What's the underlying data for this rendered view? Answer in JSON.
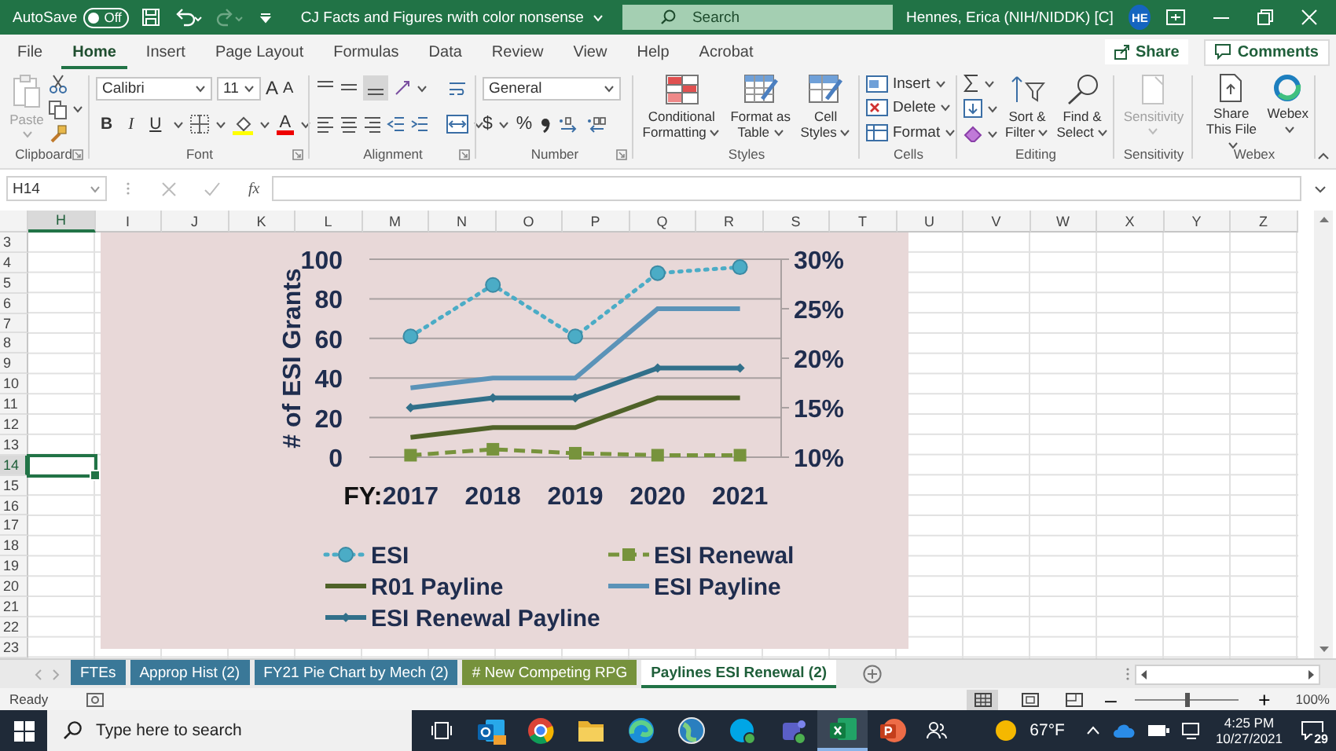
{
  "title_bar": {
    "autosave_label": "AutoSave",
    "autosave": {
      "on": false,
      "label": "Off"
    },
    "document_title": "CJ Facts and Figures rwith color nonsense",
    "search": {
      "placeholder": "Search"
    },
    "user_name": "Hennes, Erica (NIH/NIDDK) [C]",
    "user_initials": "HE"
  },
  "ribbon_tabs": [
    {
      "label": "File",
      "selected": false
    },
    {
      "label": "Home",
      "selected": true
    },
    {
      "label": "Insert",
      "selected": false
    },
    {
      "label": "Page Layout",
      "selected": false
    },
    {
      "label": "Formulas",
      "selected": false
    },
    {
      "label": "Data",
      "selected": false
    },
    {
      "label": "Review",
      "selected": false
    },
    {
      "label": "View",
      "selected": false
    },
    {
      "label": "Help",
      "selected": false
    },
    {
      "label": "Acrobat",
      "selected": false
    }
  ],
  "share_button": "Share",
  "comments_button": "Comments",
  "ribbon": {
    "clipboard": {
      "paste": "Paste",
      "label": "Clipboard"
    },
    "font": {
      "name": "Calibri",
      "size": "11",
      "grow": "A",
      "shrink": "A",
      "bold": "B",
      "italic": "I",
      "underline": "U",
      "font_color": "A",
      "label": "Font"
    },
    "alignment": {
      "label": "Alignment"
    },
    "number": {
      "format": "General",
      "currency": "$",
      "percent": "%",
      "label": "Number"
    },
    "styles": {
      "buttons": [
        "Conditional Formatting",
        "Format as Table",
        "Cell Styles"
      ],
      "label": "Styles"
    },
    "cells": {
      "buttons": [
        "Insert",
        "Delete",
        "Format"
      ],
      "label": "Cells"
    },
    "editing": {
      "buttons": [
        "Sort & Filter",
        "Find & Select"
      ],
      "label": "Editing"
    },
    "sensitivity": {
      "button": "Sensitivity",
      "disabled": true,
      "label": "Sensitivity"
    },
    "webex": {
      "buttons": [
        "Share This File",
        "Webex"
      ],
      "label": "Webex"
    }
  },
  "formula_bar": {
    "name_box": "H14",
    "function_label": "fx"
  },
  "columns": [
    {
      "label": "H",
      "selected": true
    },
    {
      "label": "I",
      "selected": false
    },
    {
      "label": "J",
      "selected": false
    },
    {
      "label": "K",
      "selected": false
    },
    {
      "label": "L",
      "selected": false
    },
    {
      "label": "M",
      "selected": false
    },
    {
      "label": "N",
      "selected": false
    },
    {
      "label": "O",
      "selected": false
    },
    {
      "label": "P",
      "selected": false
    },
    {
      "label": "Q",
      "selected": false
    },
    {
      "label": "R",
      "selected": false
    },
    {
      "label": "S",
      "selected": false
    },
    {
      "label": "T",
      "selected": false
    },
    {
      "label": "U",
      "selected": false
    },
    {
      "label": "V",
      "selected": false
    },
    {
      "label": "W",
      "selected": false
    },
    {
      "label": "X",
      "selected": false
    },
    {
      "label": "Y",
      "selected": false
    },
    {
      "label": "Z",
      "selected": false
    }
  ],
  "rows": [
    {
      "label": "3",
      "selected": false
    },
    {
      "label": "4",
      "selected": false
    },
    {
      "label": "5",
      "selected": false
    },
    {
      "label": "6",
      "selected": false
    },
    {
      "label": "7",
      "selected": false
    },
    {
      "label": "8",
      "selected": false
    },
    {
      "label": "9",
      "selected": false
    },
    {
      "label": "10",
      "selected": false
    },
    {
      "label": "11",
      "selected": false
    },
    {
      "label": "12",
      "selected": false
    },
    {
      "label": "13",
      "selected": false
    },
    {
      "label": "14",
      "selected": true
    },
    {
      "label": "15",
      "selected": false
    },
    {
      "label": "16",
      "selected": false
    },
    {
      "label": "17",
      "selected": false
    },
    {
      "label": "18",
      "selected": false
    },
    {
      "label": "19",
      "selected": false
    },
    {
      "label": "20",
      "selected": false
    },
    {
      "label": "21",
      "selected": false
    },
    {
      "label": "22",
      "selected": false
    },
    {
      "label": "23",
      "selected": false
    }
  ],
  "chart": {
    "chart_data": {
      "type": "line",
      "grid": true,
      "legend": true,
      "ylabel": "# of ESI Grants",
      "xlabel": "FY:",
      "categories": [
        "2017",
        "2018",
        "2019",
        "2020",
        "2021"
      ],
      "ylim": [
        0,
        100
      ],
      "yticks": [
        {
          "value": 0,
          "label": "0"
        },
        {
          "value": 20,
          "label": "20"
        },
        {
          "value": 40,
          "label": "40"
        },
        {
          "value": 60,
          "label": "60"
        },
        {
          "value": 80,
          "label": "80"
        },
        {
          "value": 100,
          "label": "100"
        }
      ],
      "y2lim": [
        0.1,
        0.3
      ],
      "y2ticks": [
        {
          "value": 0.1,
          "label": "10%"
        },
        {
          "value": 0.15,
          "label": "15%"
        },
        {
          "value": 0.2,
          "label": "20%"
        },
        {
          "value": 0.25,
          "label": "25%"
        },
        {
          "value": 0.3,
          "label": "30%"
        }
      ],
      "series": [
        {
          "name": "ESI",
          "color": "#4bacc6",
          "line_style": "dotted",
          "marker": "circle",
          "values": [
            61,
            87,
            61,
            93,
            96
          ]
        },
        {
          "name": "ESI Renewal",
          "color": "#77933c",
          "line_style": "dashed",
          "marker": "square",
          "values": [
            1,
            4,
            2,
            1,
            1
          ]
        },
        {
          "name": "R01 Payline",
          "color": "#4f6228",
          "line_style": "solid",
          "marker": "none",
          "values": [
            10,
            15,
            15,
            30,
            30
          ]
        },
        {
          "name": "ESI Payline",
          "color": "#5b93b8",
          "line_style": "solid",
          "marker": "none",
          "values": [
            35,
            40,
            40,
            75,
            75
          ]
        },
        {
          "name": "ESI Renewal Payline",
          "color": "#31708a",
          "line_style": "solid",
          "marker": "diamond",
          "values": [
            25,
            30,
            30,
            45,
            45
          ]
        }
      ]
    }
  },
  "sheet_tabs": [
    {
      "label": "FTEs",
      "color": "#3a7898",
      "selected": false
    },
    {
      "label": "Approp Hist (2)",
      "color": "#3a7898",
      "selected": false
    },
    {
      "label": "FY21 Pie Chart by Mech (2)",
      "color": "#3a7898",
      "selected": false
    },
    {
      "label": "# New Competing RPG",
      "color": "#76923c",
      "selected": false
    },
    {
      "label": "Paylines ESI Renewal (2)",
      "color": "#217346",
      "selected": true
    }
  ],
  "status_bar": {
    "text": "Ready",
    "zoom_out": "–",
    "zoom_in": "+",
    "zoom": {
      "level": 0.5
    },
    "zoom_label": "100%"
  },
  "taskbar": {
    "search": {
      "placeholder": "Type here to search"
    },
    "apps": [
      {
        "kind": "mail",
        "selected": false
      },
      {
        "kind": "browser",
        "selected": false
      },
      {
        "kind": "folder",
        "selected": false
      },
      {
        "kind": "edge",
        "selected": false
      },
      {
        "kind": "globe",
        "selected": false
      },
      {
        "kind": "chat",
        "selected": false
      },
      {
        "kind": "teams",
        "selected": false
      },
      {
        "kind": "spreadsheet",
        "selected": true
      },
      {
        "kind": "presentation",
        "selected": false
      }
    ],
    "temperature": "67°F",
    "time": "4:25 PM",
    "date": "10/27/2021",
    "notifications": "29"
  }
}
